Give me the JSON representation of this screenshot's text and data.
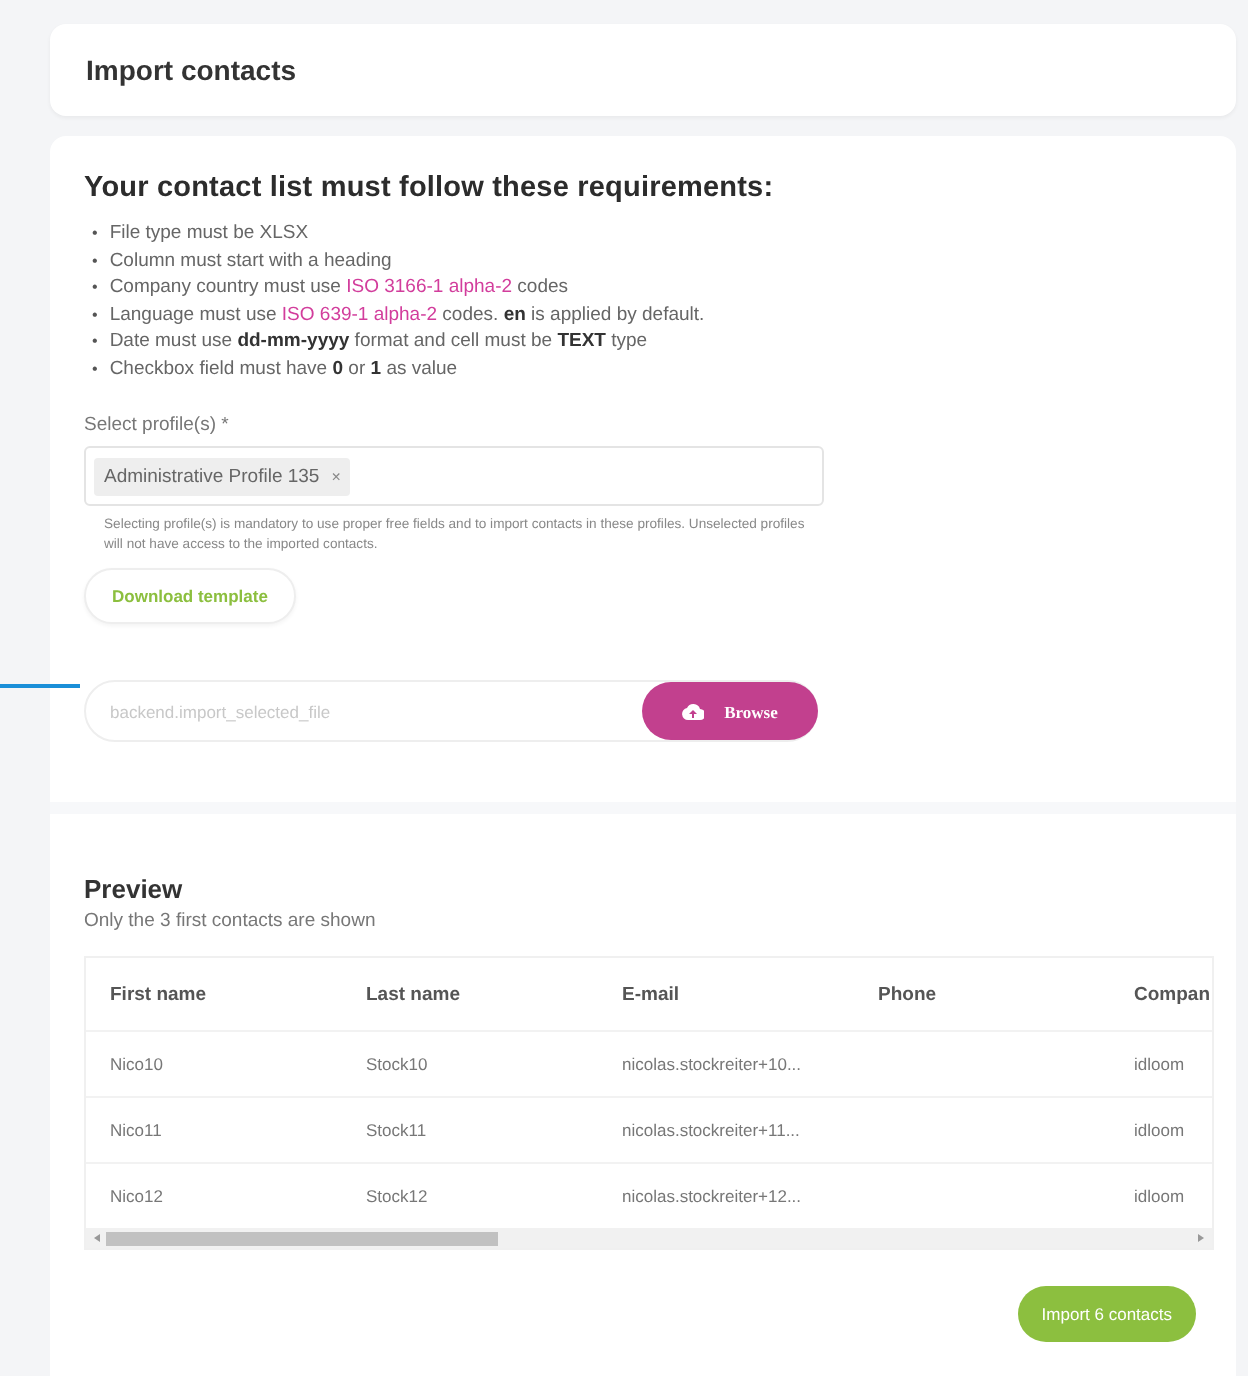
{
  "header": {
    "title": "Import contacts"
  },
  "requirements": {
    "heading": "Your contact list must follow these requirements:",
    "items": [
      {
        "bullet": "•",
        "parts": [
          {
            "kind": "text",
            "text": "File type must be XLSX"
          }
        ]
      },
      {
        "bullet": "•",
        "parts": [
          {
            "kind": "text",
            "text": "Column must start with a heading"
          }
        ]
      },
      {
        "bullet": "•",
        "parts": [
          {
            "kind": "text",
            "text": "Company country must use "
          },
          {
            "kind": "link",
            "text": "ISO 3166-1 alpha-2"
          },
          {
            "kind": "text",
            "text": " codes"
          }
        ]
      },
      {
        "bullet": "•",
        "parts": [
          {
            "kind": "text",
            "text": "Language must use "
          },
          {
            "kind": "link",
            "text": "ISO 639-1 alpha-2"
          },
          {
            "kind": "text",
            "text": " codes. **en** is applied by default."
          }
        ]
      },
      {
        "bullet": "•",
        "parts": [
          {
            "kind": "text",
            "text": "Date must use **dd-mm-yyyy** format and cell must be **TEXT** type"
          }
        ]
      },
      {
        "bullet": "•",
        "parts": [
          {
            "kind": "text",
            "text": "Checkbox field must have **0** or **1** as value"
          }
        ]
      }
    ]
  },
  "profiles": {
    "label": "Select profile(s)",
    "required_mark": "*",
    "tags": [
      {
        "label": "Administrative Profile 135",
        "remove": "×"
      }
    ],
    "help": "Selecting profile(s) is mandatory to use proper free fields and to import contacts in these profiles. Unselected profiles will not have access to the imported contacts."
  },
  "download_button": "Download template",
  "file": {
    "placeholder": "backend.import_selected_file",
    "browse_button": "Browse"
  },
  "preview": {
    "heading": "Preview",
    "subtitle": "Only the 3 first contacts are shown",
    "columns": [
      "First name",
      "Last name",
      "E-mail",
      "Phone",
      "Compan"
    ],
    "rows": [
      {
        "first_name": "Nico10",
        "last_name": "Stock10",
        "email": "nicolas.stockreiter+10...",
        "company": "idloom"
      },
      {
        "first_name": "Nico11",
        "last_name": "Stock11",
        "email": "nicolas.stockreiter+11...",
        "company": "idloom"
      },
      {
        "first_name": "Nico12",
        "last_name": "Stock12",
        "email": "nicolas.stockreiter+12...",
        "company": "idloom"
      }
    ]
  },
  "import_button": "Import 6 contacts"
}
